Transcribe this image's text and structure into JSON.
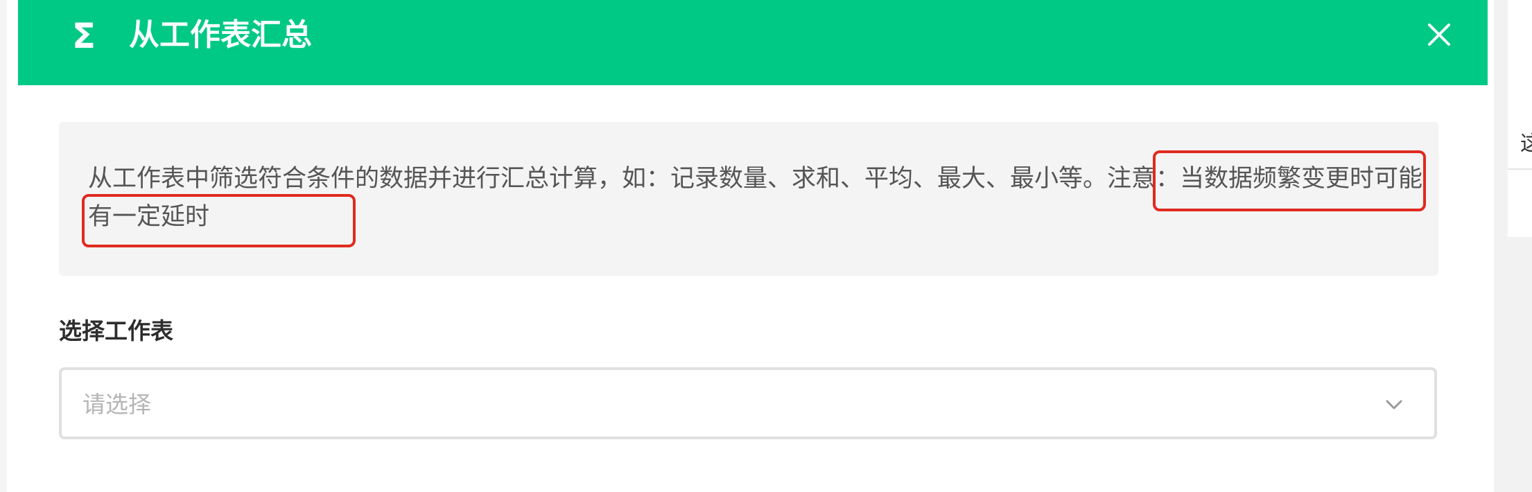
{
  "dialog": {
    "title": "从工作表汇总",
    "header_icon": "sigma-icon",
    "close_icon": "close-icon",
    "header_color": "#00c985"
  },
  "notice": {
    "text": "从工作表中筛选符合条件的数据并进行汇总计算，如：记录数量、求和、平均、最大、最小等。注意：当数据频繁变更时可能有一定延时",
    "highlight_color": "#e02a1f"
  },
  "worksheet_select": {
    "label": "选择工作表",
    "placeholder": "请选择",
    "icon": "chevron-down-icon"
  },
  "right_panel": {
    "partial_text": "这"
  }
}
